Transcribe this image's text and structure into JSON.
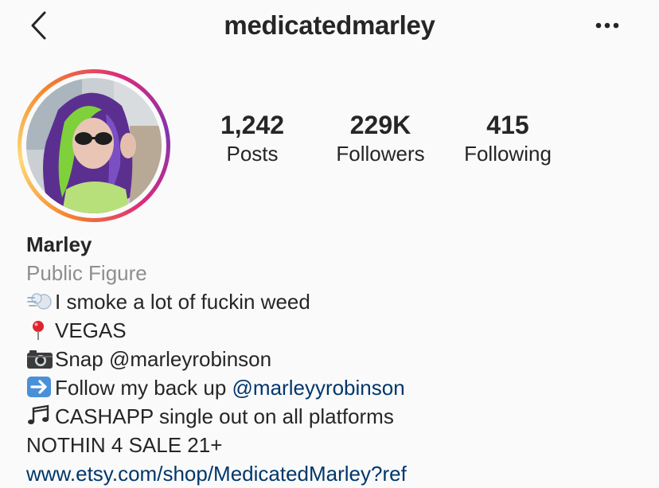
{
  "header": {
    "username": "medicatedmarley",
    "back_icon": "chevron-left-icon",
    "more_icon": "ellipsis-icon"
  },
  "profile": {
    "avatar_ring_colors": [
      "#f58529",
      "#dd2a7b",
      "#8134af"
    ]
  },
  "stats": [
    {
      "value": "1,242",
      "label": "Posts"
    },
    {
      "value": "229K",
      "label": "Followers"
    },
    {
      "value": "415",
      "label": "Following"
    }
  ],
  "bio": {
    "name": "Marley",
    "category": "Public Figure",
    "line1_icon": "dash-smoke-icon",
    "line1_text": "I smoke a lot of fuckin weed",
    "line2_icon": "round-pushpin-icon",
    "line2_text": "VEGAS",
    "line3_icon": "camera-icon",
    "line3_text": "Snap @marleyrobinson",
    "line4_icon": "right-arrow-icon",
    "line4_text": "Follow my back up ",
    "line4_mention": "@marleyyrobinson",
    "line5_icon": "music-notes-icon",
    "line5_text": "CASHAPP single out on all platforms",
    "line6_text": "NOTHIN 4 SALE 21+",
    "website": "www.etsy.com/shop/MedicatedMarley?ref"
  },
  "colors": {
    "background": "#fafafa",
    "text": "#262626",
    "secondary": "#8e8e8e",
    "link": "#00376b"
  }
}
